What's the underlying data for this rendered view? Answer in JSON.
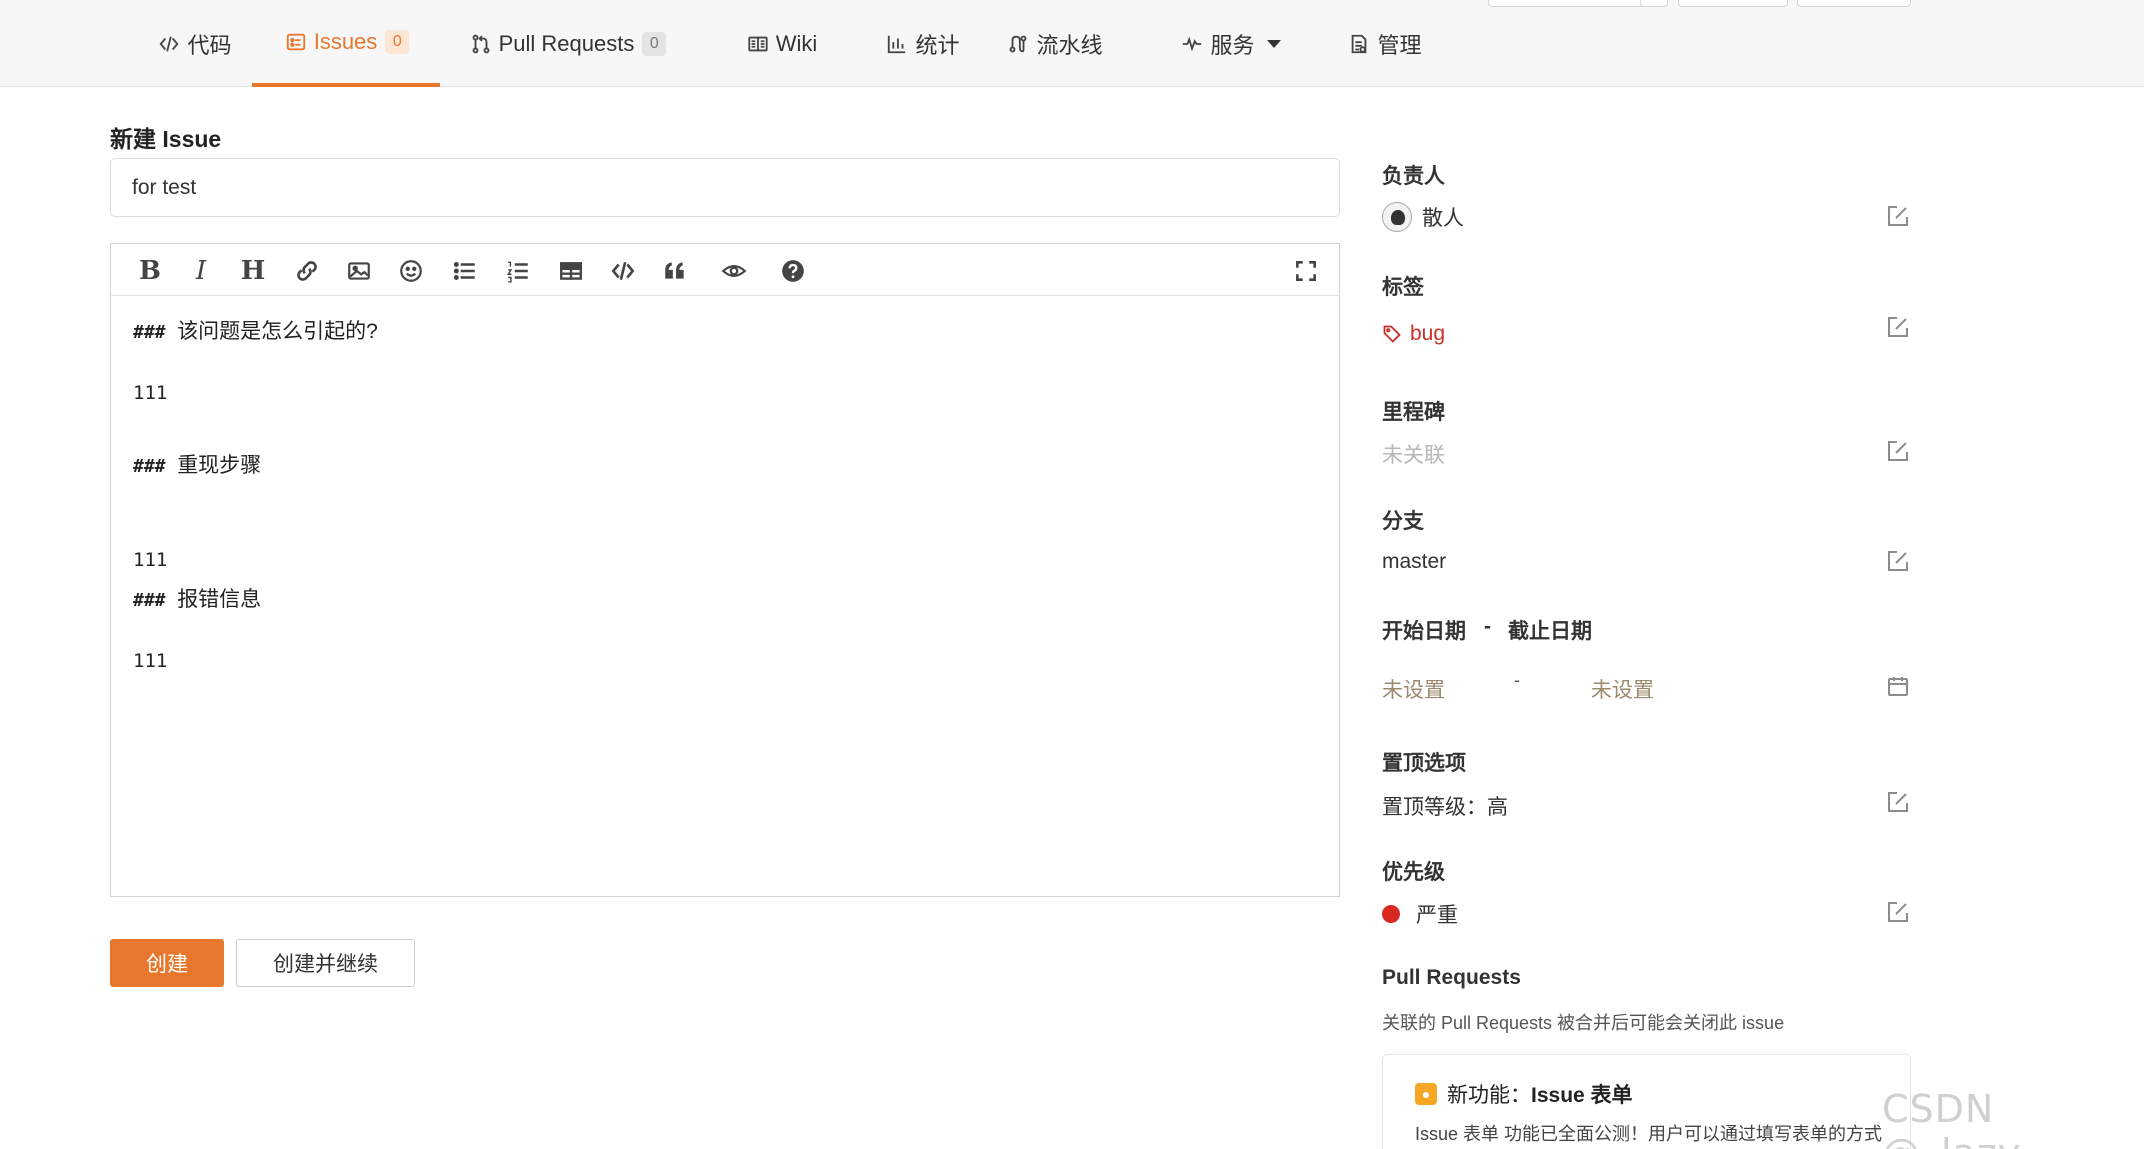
{
  "nav": {
    "tabs": [
      {
        "label": "代码",
        "icon": "code-icon",
        "active": false
      },
      {
        "label": "Issues",
        "icon": "issues-icon",
        "badge": "0",
        "active": true
      },
      {
        "label": "Pull Requests",
        "icon": "pull-request-icon",
        "badge": "0",
        "active": false
      },
      {
        "label": "Wiki",
        "icon": "wiki-icon",
        "active": false
      },
      {
        "label": "统计",
        "icon": "stats-icon",
        "active": false
      },
      {
        "label": "流水线",
        "icon": "pipeline-icon",
        "active": false
      },
      {
        "label": "服务",
        "icon": "pulse-icon",
        "active": false
      },
      {
        "label": "管理",
        "icon": "manage-icon",
        "active": false
      }
    ]
  },
  "form": {
    "heading": "新建 Issue",
    "title_value": "for test",
    "editor_lines": [
      {
        "hash": "###",
        "text": "该问题是怎么引起的?"
      },
      {
        "hash": "",
        "text": "111"
      },
      {
        "hash": "###",
        "text": "重现步骤"
      },
      {
        "hash": "",
        "text": "111"
      },
      {
        "hash": "###",
        "text": "报错信息"
      },
      {
        "hash": "",
        "text": "111"
      }
    ],
    "toolbar": {
      "bold": "B",
      "italic": "I",
      "heading": "H",
      "icons": [
        "bold-icon",
        "italic-icon",
        "heading-icon",
        "link-icon",
        "image-icon",
        "emoji-icon",
        "unordered-list-icon",
        "ordered-list-icon",
        "table-icon",
        "code-icon",
        "quote-icon",
        "preview-eye-icon",
        "help-icon",
        "fullscreen-icon"
      ]
    },
    "create_label": "创建",
    "create_continue_label": "创建并继续"
  },
  "sidebar": {
    "assignee": {
      "label": "负责人",
      "value": "散人"
    },
    "labels": {
      "label": "标签",
      "value": "bug",
      "color": "#c9302c"
    },
    "milestone": {
      "label": "里程碑",
      "value": "未关联"
    },
    "branch": {
      "label": "分支",
      "value": "master"
    },
    "dates": {
      "start_label": "开始日期",
      "dash": "-",
      "due_label": "截止日期",
      "start_value": "未设置",
      "due_value": "未设置"
    },
    "pin": {
      "label": "置顶选项",
      "value": "置顶等级：高"
    },
    "priority": {
      "label": "优先级",
      "value": "严重",
      "color": "#d8281f"
    },
    "pull_requests": {
      "label": "Pull Requests",
      "desc": "关联的 Pull Requests 被合并后可能会关闭此 issue"
    },
    "notice": {
      "title_prefix": "新功能：",
      "title_bold": "Issue 表单",
      "body": "Issue 表单 功能已全面公测！用户可以通过填写表单的方式快速提交 Issue，点此了解如何创建 Issue 表单"
    }
  },
  "watermark": "CSDN @_lazy.",
  "colors": {
    "accent": "#e8772e",
    "danger": "#d8281f"
  }
}
